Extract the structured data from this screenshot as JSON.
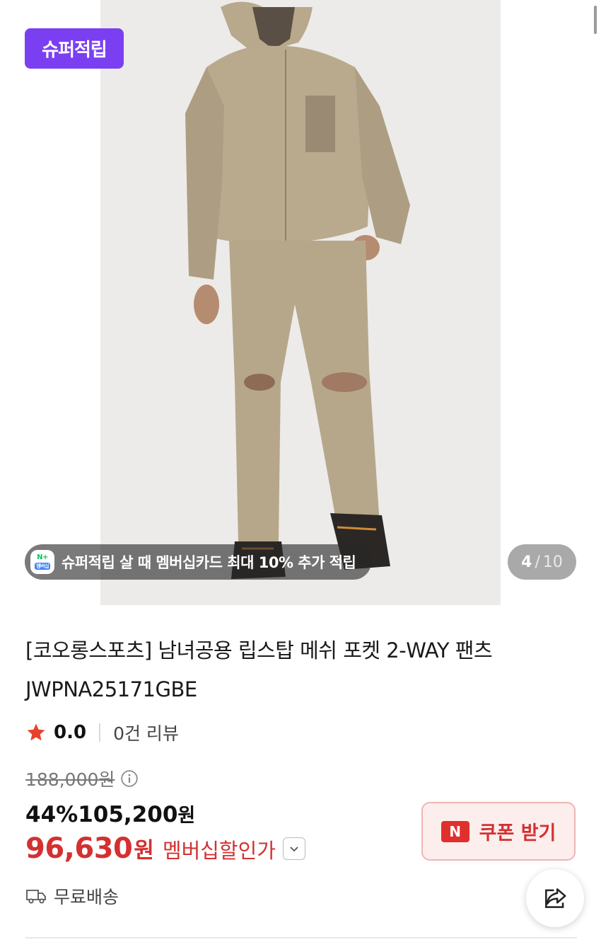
{
  "gallery": {
    "badge": "슈퍼적립",
    "promo_text": "슈퍼적립 살 때 멤버십카드 최대 10% 추가 적립",
    "promo_icon": {
      "top": "N+",
      "bottom": "멤버십"
    },
    "counter": {
      "current": "4",
      "separator": "/",
      "total": "10"
    }
  },
  "product": {
    "title_line1": "[코오롱스포츠] 남녀공용 립스탑 메쉬 포켓 2-WAY 팬츠",
    "title_line2": "JWPNA25171GBE",
    "rating": "0.0",
    "review_count": "0건 리뷰",
    "original_price": "188,000원",
    "discount": "44%",
    "sale_price": "105,200",
    "sale_currency": "원",
    "member_price": "96,630",
    "member_currency": "원",
    "member_label": "멤버십할인가",
    "coupon_logo": "N",
    "coupon_label": "쿠폰 받기",
    "shipping": "무료배송"
  },
  "colors": {
    "badge_purple": "#7b3ff2",
    "price_red": "#d43030",
    "star_red": "#e8412c",
    "coupon_bg": "#fdeeee"
  }
}
